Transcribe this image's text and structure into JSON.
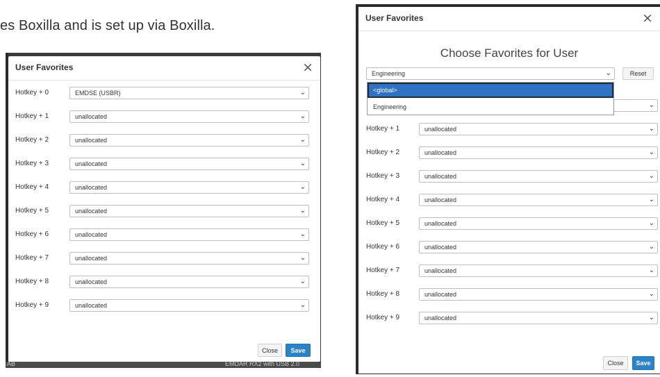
{
  "doc": {
    "top_text": "",
    "body_text": "es Boxilla and is set up via Boxilla."
  },
  "left": {
    "title": "User Favorites",
    "rows": [
      {
        "label": "Hotkey + 0",
        "value": "EMDSE (USBR)"
      },
      {
        "label": "Hotkey + 1",
        "value": "unallocated"
      },
      {
        "label": "Hotkey + 2",
        "value": "unallocated"
      },
      {
        "label": "Hotkey + 3",
        "value": "unallocated"
      },
      {
        "label": "Hotkey + 4",
        "value": "unallocated"
      },
      {
        "label": "Hotkey + 5",
        "value": "unallocated"
      },
      {
        "label": "Hotkey + 6",
        "value": "unallocated"
      },
      {
        "label": "Hotkey + 7",
        "value": "unallocated"
      },
      {
        "label": "Hotkey + 8",
        "value": "unallocated"
      },
      {
        "label": "Hotkey + 9",
        "value": "unallocated"
      }
    ],
    "close_label": "Close",
    "save_label": "Save",
    "bg_left_number": "AB",
    "bg_bottom_text": "EMDAR RX2 with USB 2.0"
  },
  "right": {
    "title": "User Favorites",
    "heading": "Choose Favorites for User",
    "group_select": "Engineering",
    "reset_label": "Reset",
    "dropdown_options": [
      "<global>",
      "Engineering"
    ],
    "rows": [
      {
        "label": "Hotkey + 1",
        "value": "unallocated"
      },
      {
        "label": "Hotkey + 2",
        "value": "unallocated"
      },
      {
        "label": "Hotkey + 3",
        "value": "unallocated"
      },
      {
        "label": "Hotkey + 4",
        "value": "unallocated"
      },
      {
        "label": "Hotkey + 5",
        "value": "unallocated"
      },
      {
        "label": "Hotkey + 6",
        "value": "unallocated"
      },
      {
        "label": "Hotkey + 7",
        "value": "unallocated"
      },
      {
        "label": "Hotkey + 8",
        "value": "unallocated"
      },
      {
        "label": "Hotkey + 9",
        "value": "unallocated"
      }
    ],
    "close_label": "Close",
    "save_label": "Save"
  },
  "icons": {
    "close": "×",
    "chevron": "⌄"
  },
  "colors": {
    "primary": "#2b82c9",
    "dropdown_highlight": "#2f72c4"
  }
}
